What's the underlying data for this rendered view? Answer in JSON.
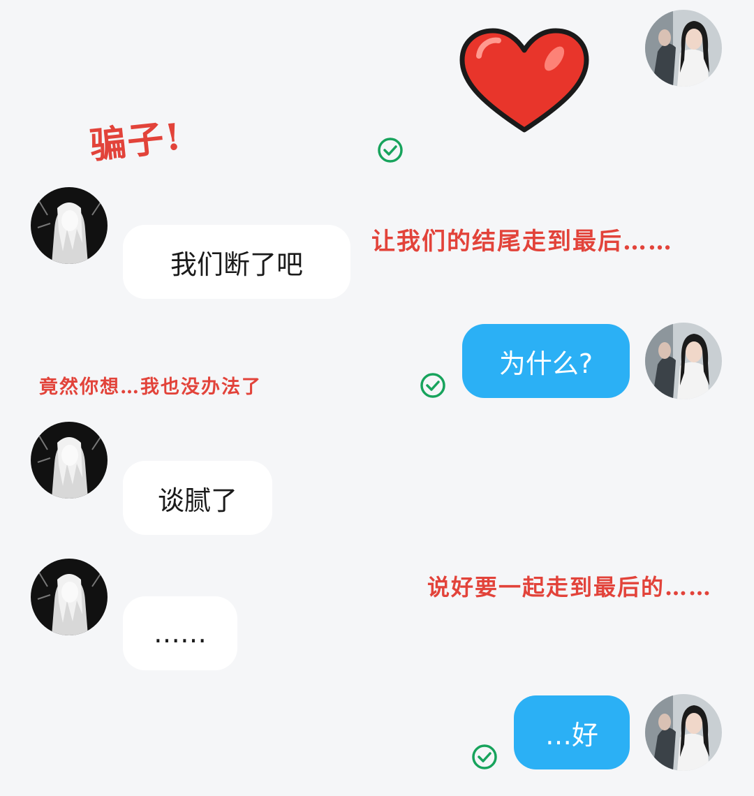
{
  "colors": {
    "background": "#f5f6f8",
    "incoming_bubble": "#ffffff",
    "outgoing_bubble": "#2bb0f5",
    "check": "#17a35c",
    "overlay_text": "#e2433a"
  },
  "overlays": {
    "liar": "骗子!",
    "let_end": "让我们的结尾走到最后……",
    "since_you_want": "竟然你想…我也没办法了",
    "promised": "说好要一起走到最后的……"
  },
  "messages": [
    {
      "from": "self",
      "type": "sticker",
      "icon": "heart-sticker",
      "status": "sent"
    },
    {
      "from": "other",
      "type": "text",
      "text": "我们断了吧"
    },
    {
      "from": "self",
      "type": "text",
      "text": "为什么?",
      "status": "sent"
    },
    {
      "from": "other",
      "type": "text",
      "text": "谈腻了"
    },
    {
      "from": "other",
      "type": "text",
      "text": "……"
    },
    {
      "from": "self",
      "type": "text",
      "text": "…好",
      "status": "sent"
    }
  ]
}
